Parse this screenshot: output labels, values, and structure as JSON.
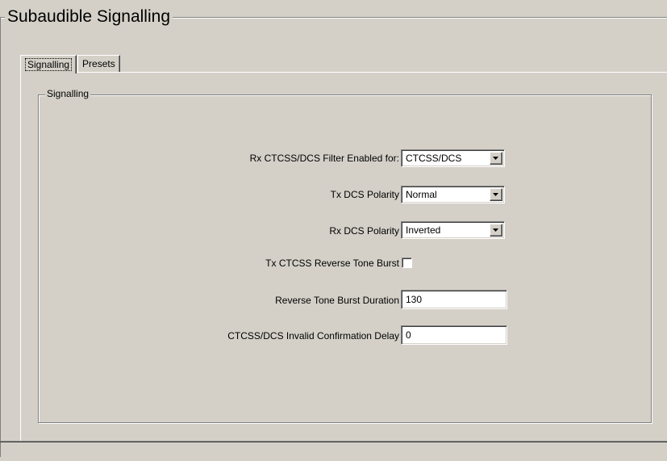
{
  "page": {
    "title": "Subaudible Signalling"
  },
  "tabs": [
    {
      "label": "Signalling",
      "active": true
    },
    {
      "label": "Presets",
      "active": false
    }
  ],
  "group": {
    "title": "Signalling"
  },
  "fields": {
    "rx_filter": {
      "label": "Rx CTCSS/DCS Filter Enabled for:",
      "value": "CTCSS/DCS"
    },
    "tx_dcs_polarity": {
      "label": "Tx DCS Polarity",
      "value": "Normal"
    },
    "rx_dcs_polarity": {
      "label": "Rx DCS Polarity",
      "value": "Inverted"
    },
    "tx_reverse_burst": {
      "label": "Tx CTCSS Reverse Tone Burst",
      "checked": false
    },
    "reverse_burst_duration": {
      "label": "Reverse Tone Burst Duration",
      "value": "130"
    },
    "invalid_confirmation_delay": {
      "label": "CTCSS/DCS Invalid Confirmation Delay",
      "value": "0"
    }
  },
  "icons": {
    "dropdown": "chevron-down-icon"
  },
  "colors": {
    "background": "#d4d0c8",
    "field": "#ffffff",
    "shadow": "#808080",
    "highlight": "#ffffff"
  }
}
